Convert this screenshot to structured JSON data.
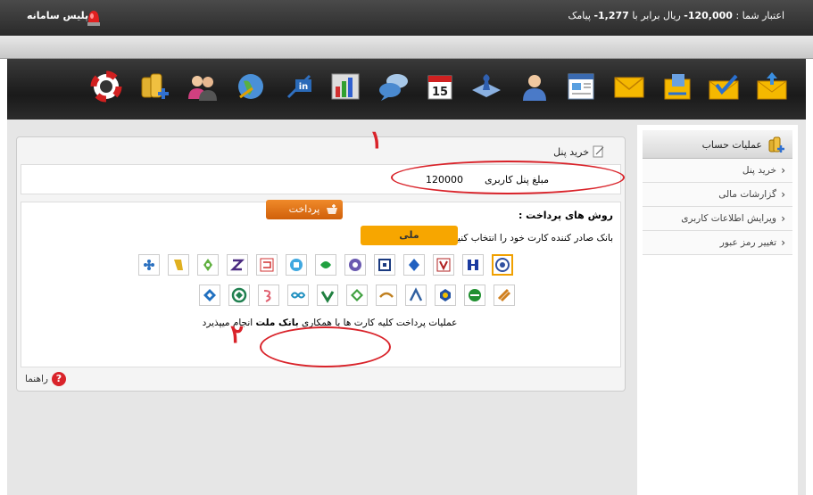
{
  "top_bar": {
    "credit_prefix": "اعتبار شما : ",
    "credit_amount": "120,000-",
    "credit_mid": " ریال برابر با ",
    "credit_sms": "1,277-",
    "credit_suffix": " پیامک",
    "brand": "پلیس سامانه"
  },
  "toolbar": {
    "icons": [
      "upload-mail-icon",
      "check-mail-icon",
      "phonebook-mail-icon",
      "mail-icon",
      "newsletter-icon",
      "user-support-icon",
      "chat-icon",
      "chess-icon",
      "calendar-icon",
      "speech-bubbles-icon",
      "bar-chart-icon",
      "linkedin-icon",
      "globe-icon",
      "users-icon",
      "coins-add-icon",
      "lifebuoy-icon"
    ],
    "calendar_day": "15"
  },
  "panel": {
    "title": "خرید پنل",
    "amount_label": "مبلغ پنل کاربری",
    "amount_value": "120000",
    "payment_title": "روش های پرداخت :",
    "bank_select_label": "بانک صادر کننده کارت خود را انتخاب کنید:",
    "bank_selected": "ملی",
    "note_prefix": "عملیات پرداخت کلیه کارت ها با همکاری ",
    "note_bank": "بانک ملت",
    "note_suffix": " انجام میپذیرد",
    "pay_button": "پرداخت",
    "help_label": "راهنما"
  },
  "annotations": {
    "one": "۱",
    "two": "۲"
  },
  "sidebar": {
    "title": "عملیات حساب",
    "items": [
      "خرید پنل",
      "گزارشات مالی",
      "ویرایش اطلاعات کاربری",
      "تغییر رمز عبور"
    ]
  },
  "banks_row1": [
    "melli",
    "mellat",
    "saderat",
    "sepah",
    "tejarat",
    "keshavarzi",
    "post",
    "refah",
    "maskan",
    "sarmayeh",
    "parsian",
    "eghtesad",
    "karafarin",
    "tosee",
    "ayandeh"
  ],
  "banks_row2": [
    "sina",
    "pasargad",
    "saman",
    "eghtesad-novin",
    "ansar",
    "kar",
    "hekmat",
    "gardeshgari",
    "dey",
    "ghavamin",
    "markazi"
  ],
  "colors": {
    "accent": "#f7a600",
    "annotation": "#d9232a",
    "pay_button": "#e07420"
  }
}
